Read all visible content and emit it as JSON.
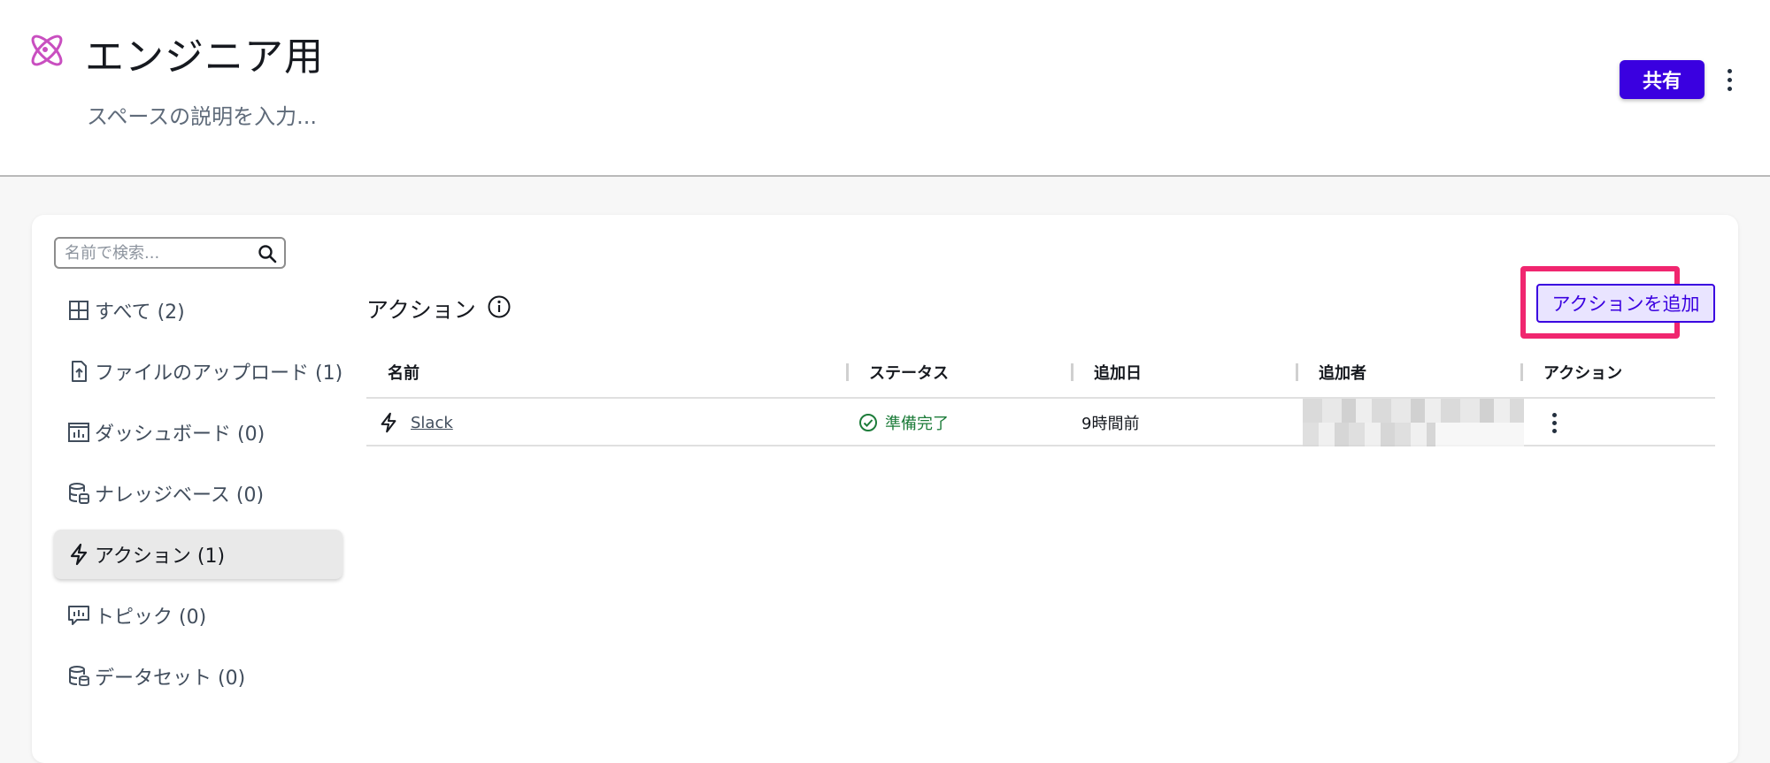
{
  "header": {
    "title": "エンジニア用",
    "description": "スペースの説明を入力...",
    "share_label": "共有",
    "space_icon": "atom-icon",
    "accent_color": "#3a00e0"
  },
  "sidebar": {
    "search_placeholder": "名前で検索...",
    "items": [
      {
        "label": "すべて (2)",
        "icon": "grid-icon"
      },
      {
        "label": "ファイルのアップロード (1)",
        "icon": "file-upload-icon"
      },
      {
        "label": "ダッシュボード (0)",
        "icon": "dashboard-icon"
      },
      {
        "label": "ナレッジベース (0)",
        "icon": "database-icon"
      },
      {
        "label": "アクション (1)",
        "icon": "lightning-icon",
        "active": true
      },
      {
        "label": "トピック (0)",
        "icon": "topic-icon"
      },
      {
        "label": "データセット (0)",
        "icon": "dataset-icon"
      }
    ]
  },
  "main": {
    "section_title": "アクション",
    "add_button_label": "アクションを追加",
    "table": {
      "columns": [
        "名前",
        "ステータス",
        "追加日",
        "追加者",
        "アクション"
      ],
      "rows": [
        {
          "name": "Slack",
          "status": "準備完了",
          "added": "9時間前",
          "added_by": ""
        }
      ]
    },
    "highlight_color": "#f0266f",
    "status_color": "#1d7c3a"
  }
}
